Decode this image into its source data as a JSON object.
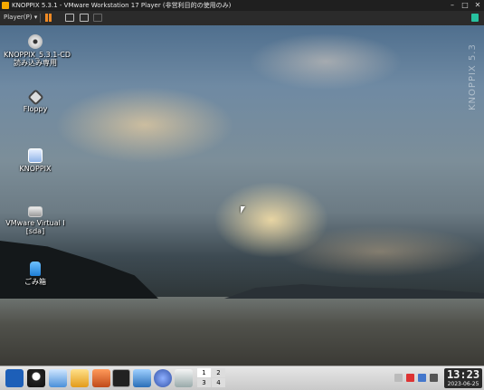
{
  "window": {
    "title": "KNOPPIX 5.3.1 - VMware Workstation 17 Player (非営利目的の使用のみ)"
  },
  "toolbar": {
    "player_menu": "Player(P) ▾"
  },
  "desktop": {
    "watermark": "KNOPPIX 5.3",
    "icons": [
      {
        "label": "KNOPPIX_5.3.1-CD",
        "label2": "読み込み専用",
        "icon": "cdrom-icon"
      },
      {
        "label": "Floppy",
        "icon": "floppy-icon"
      },
      {
        "label": "KNOPPIX",
        "icon": "knoppix-icon"
      },
      {
        "label": "VMware Virtual I",
        "label2": "[sda]",
        "icon": "harddisk-icon"
      },
      {
        "label": "ごみ箱",
        "icon": "trash-icon"
      }
    ]
  },
  "taskbar": {
    "launchers": [
      "kde-menu-icon",
      "tux-icon",
      "terminal-shell-icon",
      "files-icon",
      "home-icon",
      "konsole-icon",
      "network-icon",
      "browser-icon",
      "document-icon"
    ],
    "pager": [
      "1",
      "2",
      "3",
      "4"
    ],
    "tray": [
      "printer-icon",
      "flag-icon",
      "monitor-icon",
      "speaker-icon"
    ],
    "clock_time": "13:23",
    "clock_date": "2023-06-25"
  }
}
